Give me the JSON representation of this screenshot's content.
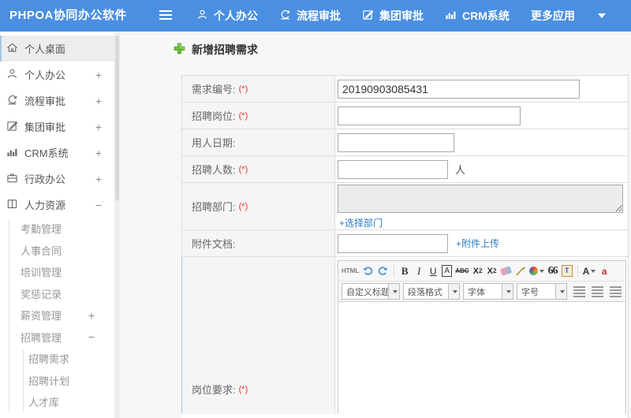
{
  "colors": {
    "header_bg": "#4a8fe2",
    "link": "#2f7cc5",
    "required": "#e03333",
    "plus_green": "#6abf3a"
  },
  "header": {
    "logo": "PHPOA协同办公软件",
    "nav": [
      {
        "label": "个人办公"
      },
      {
        "label": "流程审批"
      },
      {
        "label": "集团审批"
      },
      {
        "label": "CRM系统"
      },
      {
        "label": "更多应用"
      }
    ]
  },
  "sidebar": {
    "items": [
      {
        "label": "个人桌面"
      },
      {
        "label": "个人办公",
        "expand": "+"
      },
      {
        "label": "流程审批",
        "expand": "+"
      },
      {
        "label": "集团审批",
        "expand": "+"
      },
      {
        "label": "CRM系统",
        "expand": "+"
      },
      {
        "label": "行政办公",
        "expand": "+"
      },
      {
        "label": "人力资源",
        "expand": "−"
      }
    ],
    "hr_items": [
      {
        "label": "考勤管理"
      },
      {
        "label": "人事合同"
      },
      {
        "label": "培训管理"
      },
      {
        "label": "奖惩记录"
      },
      {
        "label": "薪资管理",
        "expand": "+"
      },
      {
        "label": "招聘管理",
        "expand": "−"
      }
    ],
    "recruit_items": [
      {
        "label": "招聘需求"
      },
      {
        "label": "招聘计划"
      },
      {
        "label": "人才库"
      }
    ]
  },
  "main": {
    "title": "新增招聘需求",
    "required_mark": "(*)",
    "form": {
      "rows": [
        {
          "label": "需求编号:",
          "value": "20190903085431"
        },
        {
          "label": "招聘岗位:"
        },
        {
          "label": "用人日期:"
        },
        {
          "label": "招聘人数:",
          "suffix": "人"
        },
        {
          "label": "招聘部门:",
          "link": "+选择部门"
        },
        {
          "label": "附件文档:",
          "link": "+附件上传"
        },
        {
          "label": "岗位要求:"
        }
      ]
    }
  },
  "editor": {
    "toolbar": {
      "html": "HTML",
      "bold": "B",
      "italic": "I",
      "underline": "U",
      "boxed": "A",
      "strike": "ABC",
      "sup_base": "X",
      "sup_exp": "2",
      "sub_base": "X",
      "sub_exp": "2",
      "quote": "66",
      "paste": "T",
      "fontcolor": "A",
      "bgcolor": "a",
      "dropdowns": [
        {
          "label": "自定义标题"
        },
        {
          "label": "段落格式"
        },
        {
          "label": "字体"
        },
        {
          "label": "字号"
        }
      ]
    }
  }
}
